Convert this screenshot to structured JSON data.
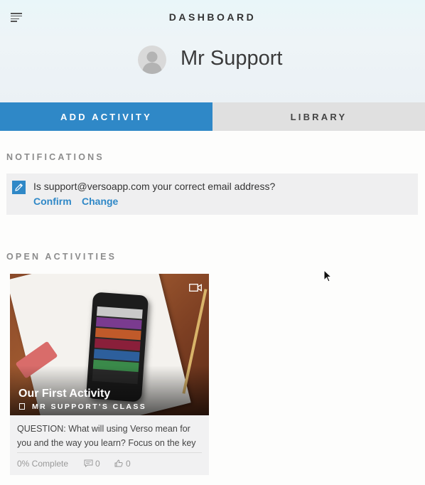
{
  "header": {
    "title": "DASHBOARD",
    "user_name": "Mr Support"
  },
  "tabs": [
    {
      "label": "ADD ACTIVITY",
      "active": true
    },
    {
      "label": "LIBRARY",
      "active": false
    }
  ],
  "notifications": {
    "heading": "NOTIFICATIONS",
    "message": "Is support@versoapp.com your correct email address?",
    "confirm_label": "Confirm",
    "change_label": "Change"
  },
  "open_activities": {
    "heading": "OPEN ACTIVITIES",
    "cards": [
      {
        "title": "Our First Activity",
        "class_name": "MR SUPPORT'S CLASS",
        "question": "QUESTION: What will using Verso mean for you and the way you learn? Focus on the key",
        "complete": "0% Complete",
        "comments": "0",
        "likes": "0"
      }
    ]
  },
  "colors": {
    "accent": "#2f88c7",
    "tab_inactive": "#e0e0e0",
    "section_heading": "#8c8c8c"
  },
  "icons": [
    "menu-icon",
    "avatar-icon",
    "pencil-edit-icon",
    "video-icon",
    "class-book-icon",
    "comment-icon",
    "like-icon",
    "mouse-cursor-icon"
  ]
}
